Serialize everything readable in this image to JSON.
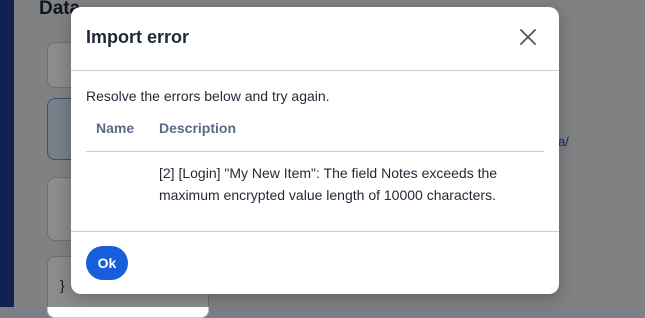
{
  "background": {
    "title_partial": "Data",
    "link_partial": "data/",
    "code_partial": "}"
  },
  "dialog": {
    "title": "Import error",
    "close_icon": "close-icon",
    "message": "Resolve the errors below and try again.",
    "table": {
      "columns": [
        "Name",
        "Description"
      ],
      "rows": [
        {
          "name": "",
          "description": "[2] [Login] \"My New Item\": The field Notes exceeds the maximum encrypted value length of 10000 characters."
        }
      ]
    },
    "ok_label": "Ok"
  },
  "colors": {
    "primary": "#175ddc",
    "sidebar": "#1f3d93",
    "overlay": "rgba(0,0,0,0.45)"
  }
}
